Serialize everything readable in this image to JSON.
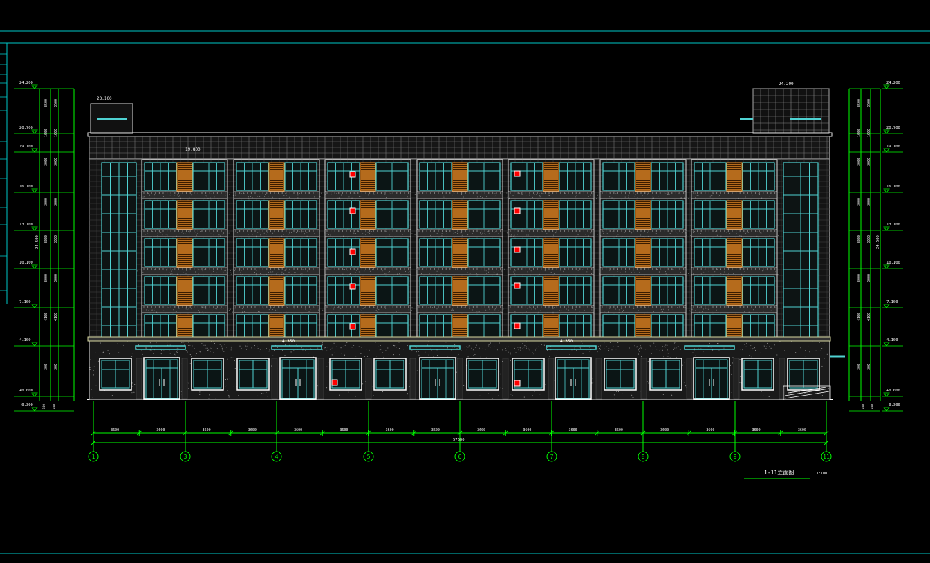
{
  "drawing": {
    "title": "1-11立面图",
    "scale": "1:100",
    "total_width_label": "57600",
    "bay_dims": [
      "3600",
      "3600",
      "3600",
      "3600",
      "3600",
      "3600",
      "3600",
      "3600",
      "3600",
      "3600",
      "3600",
      "3600",
      "3600",
      "3600",
      "3600",
      "3600"
    ],
    "axis_labels": [
      "1",
      "3",
      "4",
      "5",
      "6",
      "7",
      "8",
      "9",
      "11"
    ],
    "left_levels": [
      "24.200",
      "20.700",
      "19.100",
      "16.100",
      "13.100",
      "10.100",
      "7.100",
      "4.100",
      "±0.000",
      "-0.300"
    ],
    "right_levels": [
      "24.200",
      "20.700",
      "19.100",
      "16.100",
      "13.100",
      "10.100",
      "7.100",
      "4.100",
      "±0.000",
      "-0.300"
    ],
    "left_dims": [
      "3500",
      "1600",
      "3000",
      "3000",
      "3000",
      "3000",
      "4100",
      "300"
    ],
    "left_overall": "24.500",
    "right_overall": "24.500",
    "roof_top_left": "23.100",
    "roof_top_right": "24.200",
    "parapet_label": "19.800",
    "canopy_labels": [
      "4.350",
      "4.350"
    ],
    "colors": {
      "line_white": "#ffffff",
      "dim_green": "#00ff00",
      "window_cyan": "#4fd2d2",
      "shutter_orange": "#ff9a2e",
      "marker_red": "#ff0000",
      "frame_cyan": "#00d0d0"
    }
  }
}
